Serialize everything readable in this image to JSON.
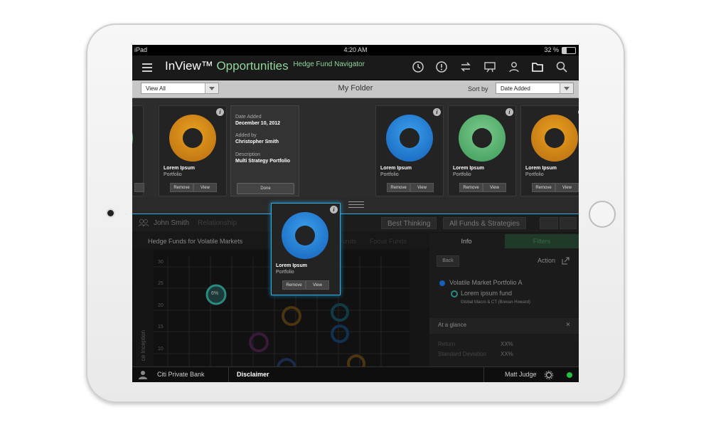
{
  "status": {
    "device": "iPad",
    "time": "4:20 AM",
    "battery": "32 %"
  },
  "app": {
    "brand": "InView™",
    "section": "Opportunities",
    "subtitle": "Hedge Fund Navigator"
  },
  "toolbar": {
    "icons": [
      "history-icon",
      "alert-icon",
      "transfer-icon",
      "presentation-icon",
      "person-icon",
      "folder-icon",
      "search-icon"
    ]
  },
  "folderbar": {
    "filter": "View All",
    "title": "My Folder",
    "sort_label": "Sort by",
    "sort_value": "Date Added"
  },
  "card_common": {
    "info": "i",
    "remove": "Remove",
    "view": "View"
  },
  "cards": [
    {
      "name": "Lorem Ipsum",
      "type": "Portfolio",
      "color": "orange"
    },
    {
      "name": "Lorem Ipsum",
      "type": "Portfolio",
      "color": "blue"
    },
    {
      "name": "Lorem Ipsum",
      "type": "Portfolio",
      "color": "green"
    },
    {
      "name": "Lorem Ipsum",
      "type": "Portfolio",
      "color": "orange"
    }
  ],
  "detail": {
    "date_label": "Date Added",
    "date_value": "December 10, 2012",
    "added_label": "Added by",
    "added_value": "Christopher Smith",
    "desc_label": "Description",
    "desc_value": "Multi Strategy Portfolio",
    "done": "Done"
  },
  "overlay_card": {
    "name": "Lorem Ipsum",
    "type": "Portfolio",
    "remove": "Remove",
    "view": "View"
  },
  "lower": {
    "user": "John Smith",
    "relationship": "Relationship",
    "pill1": "Best Thinking",
    "pill2": "All Funds & Strategies",
    "subtab1": "Hedge Funds for Volatile Markets",
    "subtab2": "Funds",
    "subtab3": "Focus Funds",
    "yticks": [
      "30",
      "25",
      "20",
      "15",
      "10"
    ],
    "ylabel": "ce Inception",
    "bubble": "6%",
    "tab_info": "Info",
    "tab_filters": "Filters",
    "back": "Back",
    "action": "Action",
    "portfolio": "Volatile Market Portfolio A",
    "fund": "Lorem ipsum fund",
    "fund_sub": "Global Macro & CT (Brevan Howard)",
    "glance": "At a glance",
    "rows": [
      {
        "k": "Return",
        "v": "XX%"
      },
      {
        "k": "Standard Deviation",
        "v": "XX%"
      }
    ]
  },
  "bottombar": {
    "bank": "Citi Private Bank",
    "disclaimer": "Disclaimer",
    "user": "Matt Judge"
  },
  "colors": {
    "accent_blue": "#2ab0e6",
    "accent_green": "#8fd49b",
    "online": "#22c03c"
  }
}
